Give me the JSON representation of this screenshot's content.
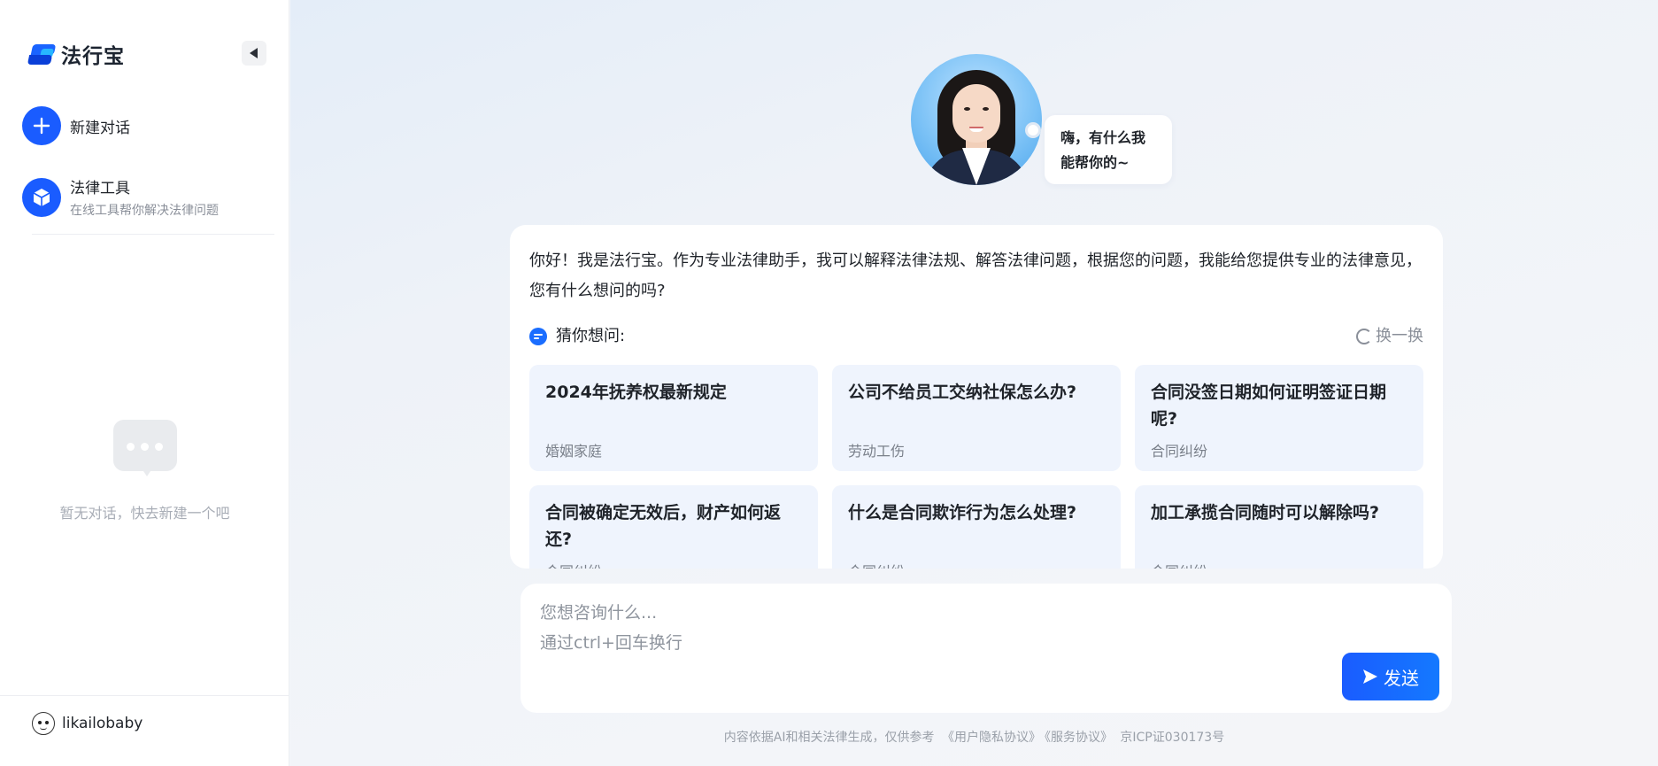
{
  "sidebar": {
    "brand": "法行宝",
    "new_chat": {
      "label": "新建对话",
      "icon": "plus-icon"
    },
    "tools": {
      "title": "法律工具",
      "subtitle": "在线工具帮你解决法律问题",
      "icon": "cube-icon"
    },
    "empty_text": "暂无对话，快去新建一个吧",
    "user": {
      "name": "likailobaby"
    }
  },
  "hero": {
    "bubble_line1": "嗨，有什么我",
    "bubble_line2": "能帮你的~"
  },
  "intro_text": "你好！我是法行宝。作为专业法律助手，我可以解释法律法规、解答法律问题，根据您的问题，我能给您提供专业的法律意见，您有什么想问的吗?",
  "guess": {
    "label": "猜你想问:",
    "refresh": "换一换",
    "questions": [
      {
        "title": "2024年抚养权最新规定",
        "tag": "婚姻家庭"
      },
      {
        "title": "公司不给员工交纳社保怎么办?",
        "tag": "劳动工伤"
      },
      {
        "title": "合同没签日期如何证明签证日期呢?",
        "tag": "合同纠纷"
      },
      {
        "title": "合同被确定无效后，财产如何返还?",
        "tag": "合同纠纷"
      },
      {
        "title": "什么是合同欺诈行为怎么处理?",
        "tag": "合同纠纷"
      },
      {
        "title": "加工承揽合同随时可以解除吗?",
        "tag": "合同纠纷"
      }
    ]
  },
  "input": {
    "placeholder_line1": "您想咨询什么...",
    "placeholder_line2": "通过ctrl+回车换行",
    "send": "发送"
  },
  "footer": {
    "disclaimer": "内容依据AI和相关法律生成，仅供参考",
    "privacy": "《用户隐私协议》",
    "service": "《服务协议》",
    "icp": "京ICP证030173号"
  },
  "colors": {
    "accent": "#1a5cff",
    "card_bg": "#eff4fd"
  }
}
